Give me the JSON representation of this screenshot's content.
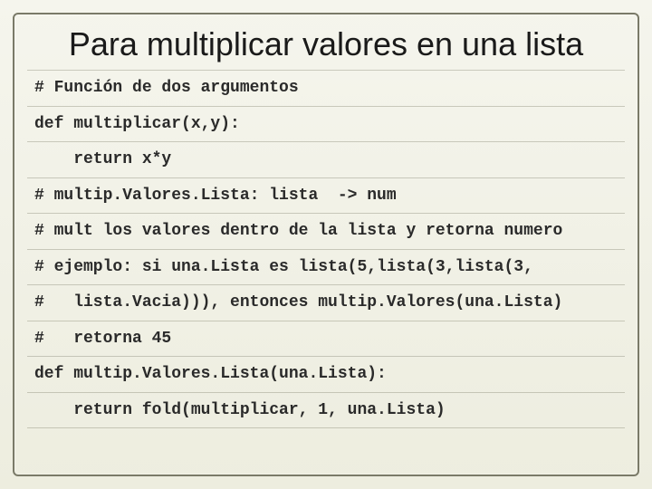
{
  "title": "Para multiplicar valores en una lista",
  "code": {
    "l0": "# Función de dos argumentos",
    "l1": "def multiplicar(x,y):",
    "l2": "    return x*y",
    "l3": "# multip.Valores.Lista: lista  -> num",
    "l4": "# mult los valores dentro de la lista y retorna numero",
    "l5": "# ejemplo: si una.Lista es lista(5,lista(3,lista(3,",
    "l6": "#   lista.Vacia))), entonces multip.Valores(una.Lista)",
    "l7": "#   retorna 45",
    "l8": "def multip.Valores.Lista(una.Lista):",
    "l9": "    return fold(multiplicar, 1, una.Lista)"
  }
}
